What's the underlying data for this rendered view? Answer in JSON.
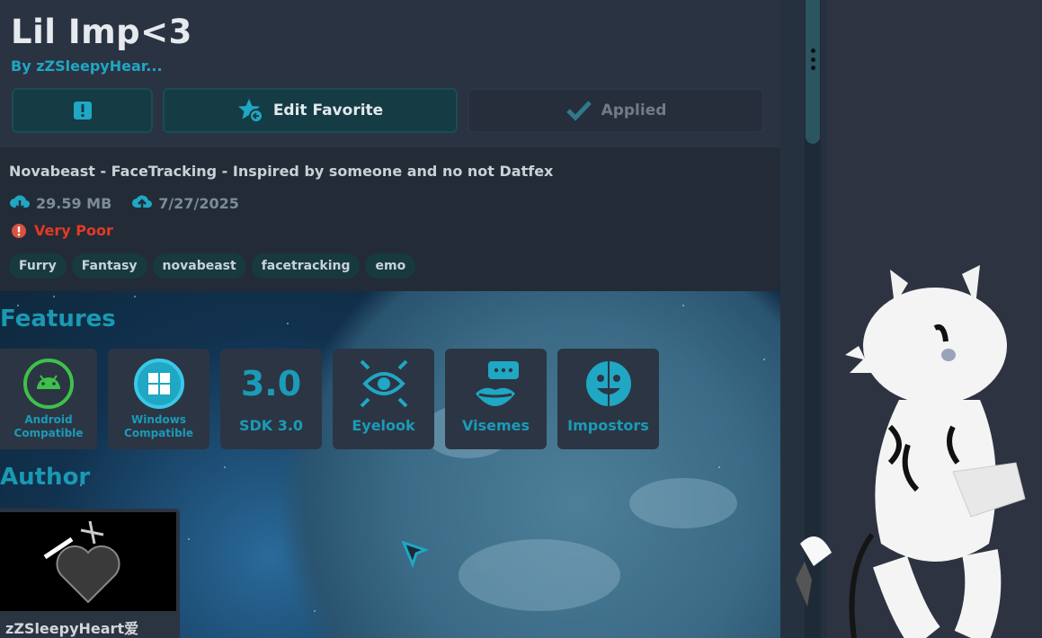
{
  "avatar": {
    "title": "Lil Imp<3",
    "byline": "By zZSleepyHear...",
    "description": "Novabeast - FaceTracking - Inspired by someone and no not Datfex",
    "file_size": "29.59 MB",
    "upload_date": "7/27/2025",
    "performance": "Very Poor",
    "tags": [
      "Furry",
      "Fantasy",
      "novabeast",
      "facetracking",
      "emo"
    ]
  },
  "actions": {
    "favorite_label": "Edit Favorite",
    "applied_label": "Applied"
  },
  "sections": {
    "features_title": "Features",
    "author_title": "Author"
  },
  "features": [
    {
      "icon": "android-icon",
      "line1": "Android",
      "line2": "Compatible"
    },
    {
      "icon": "windows-icon",
      "line1": "Windows",
      "line2": "Compatible"
    },
    {
      "icon": "sdk-icon",
      "icon_text": "3.0",
      "label": "SDK 3.0"
    },
    {
      "icon": "eye-tracking-icon",
      "label": "Eyelook"
    },
    {
      "icon": "visemes-icon",
      "label": "Visemes"
    },
    {
      "icon": "impostor-face-icon",
      "label": "Impostors"
    }
  ],
  "author": {
    "name": "zZSleepyHeart爱"
  },
  "colors": {
    "accent": "#1a99b3",
    "danger": "#e23a24",
    "panel": "#2a3342"
  }
}
